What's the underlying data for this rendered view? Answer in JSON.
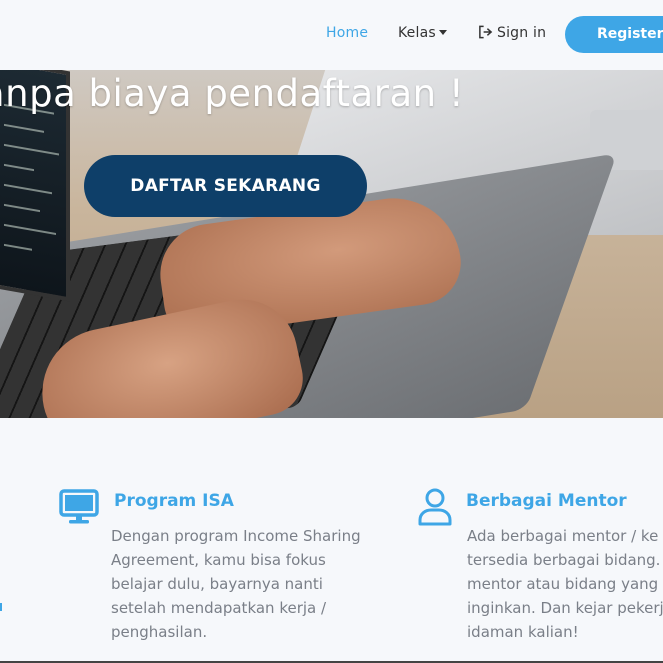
{
  "nav": {
    "home": "Home",
    "kelas": "Kelas",
    "signin": "Sign in",
    "register": "Register +"
  },
  "hero": {
    "title": "anpa biaya pendaftaran !",
    "cta": "DAFTAR SEKARANG"
  },
  "features": [
    {
      "icon": "monitor-icon",
      "title": "Program ISA",
      "lines": [
        "Dengan program Income Sharing",
        "Agreement, kamu bisa fokus",
        "belajar dulu, bayarnya nanti",
        "setelah mendapatkan kerja /",
        "penghasilan."
      ]
    },
    {
      "icon": "user-icon",
      "title": "Berbagai Mentor",
      "lines": [
        "Ada berbagai mentor / ke",
        "tersedia berbagai bidang.",
        "mentor atau bidang yang",
        "inginkan. Dan kejar pekerj",
        "idaman kalian!"
      ]
    }
  ],
  "colors": {
    "accent": "#3ea6e6",
    "cta": "#0e3f69",
    "text_muted": "#7a7f88"
  }
}
